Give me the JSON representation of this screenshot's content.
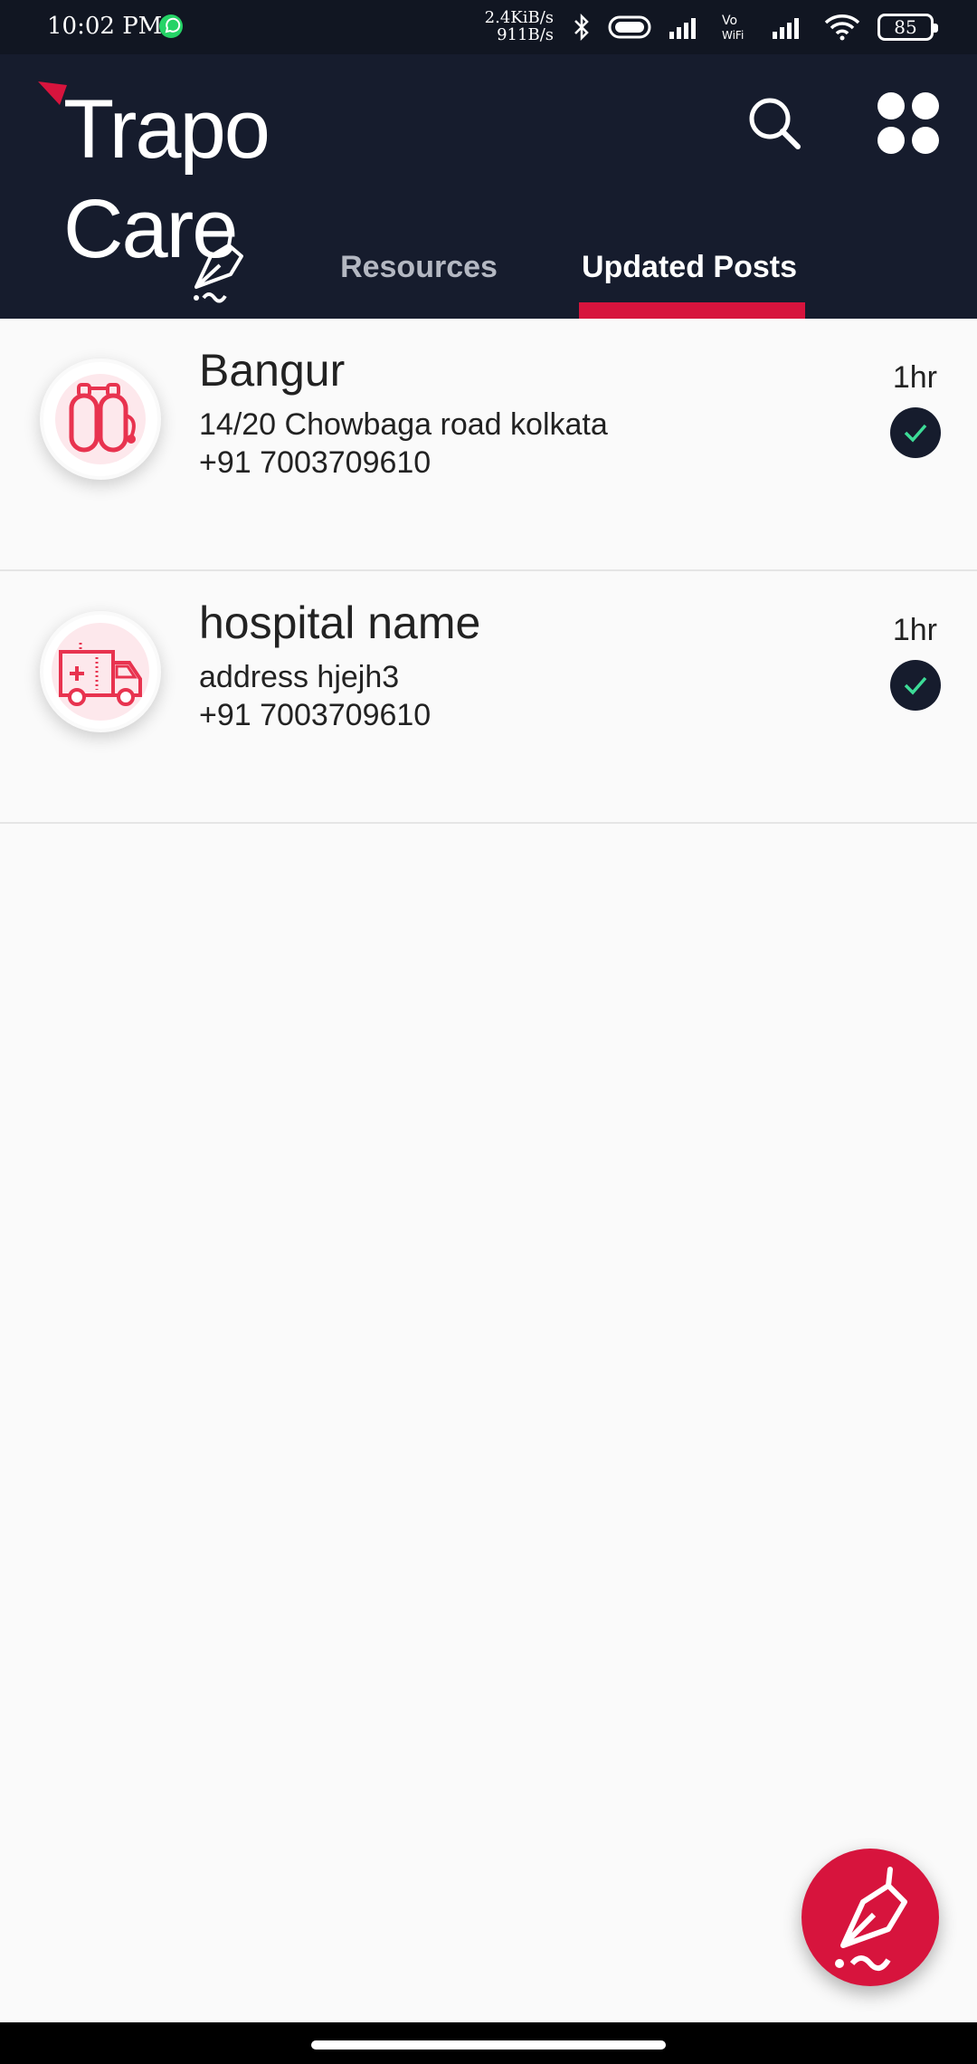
{
  "status_bar": {
    "time": "10:02 PM",
    "net_up": "2.4KiB/s",
    "net_down": "911B/s",
    "battery": "85"
  },
  "header": {
    "app_name": "Trapo Care",
    "tabs": [
      {
        "label": "",
        "icon": "post-quill-icon"
      },
      {
        "label": "Resources"
      },
      {
        "label": "Updated Posts",
        "active": true
      }
    ]
  },
  "posts": [
    {
      "title": "Bangur",
      "address": "14/20 Chowbaga road kolkata",
      "phone": "+91 7003709610",
      "time": "1hr",
      "icon": "oxygen-cylinder-icon",
      "verified": true
    },
    {
      "title": "hospital name",
      "address": "address hjejh3",
      "phone": "+91 7003709610",
      "time": "1hr",
      "icon": "ambulance-icon",
      "verified": true
    }
  ],
  "colors": {
    "header_bg": "#161c2d",
    "accent": "#d7143d",
    "check": "#3ddc97"
  }
}
